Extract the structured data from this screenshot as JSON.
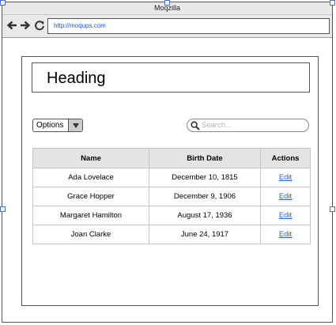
{
  "window": {
    "title": "Moqzilla"
  },
  "navbar": {
    "back_icon": "arrow-left-icon",
    "forward_icon": "arrow-right-icon",
    "reload_icon": "reload-icon",
    "url": "http://moqups.com"
  },
  "page": {
    "heading": "Heading",
    "options_select": {
      "selected": "Options",
      "icon": "caret-down-icon"
    },
    "search": {
      "placeholder": "Search...",
      "icon": "magnifier-icon"
    },
    "table": {
      "columns": [
        "Name",
        "Birth Date",
        "Actions"
      ],
      "rows": [
        {
          "name": "Ada Lovelace",
          "birth_date": "December 10, 1815",
          "action": "Edit"
        },
        {
          "name": "Grace Hopper",
          "birth_date": "December 9, 1906",
          "action": "Edit"
        },
        {
          "name": "Margaret Hamilton",
          "birth_date": "August 17, 1936",
          "action": "Edit"
        },
        {
          "name": "Joan Clarke",
          "birth_date": "June 24, 1917",
          "action": "Edit"
        }
      ]
    }
  },
  "colors": {
    "link": "#1f5fcc",
    "selection_handle": "#4a6fd4",
    "chrome": "#e9e9e9"
  }
}
